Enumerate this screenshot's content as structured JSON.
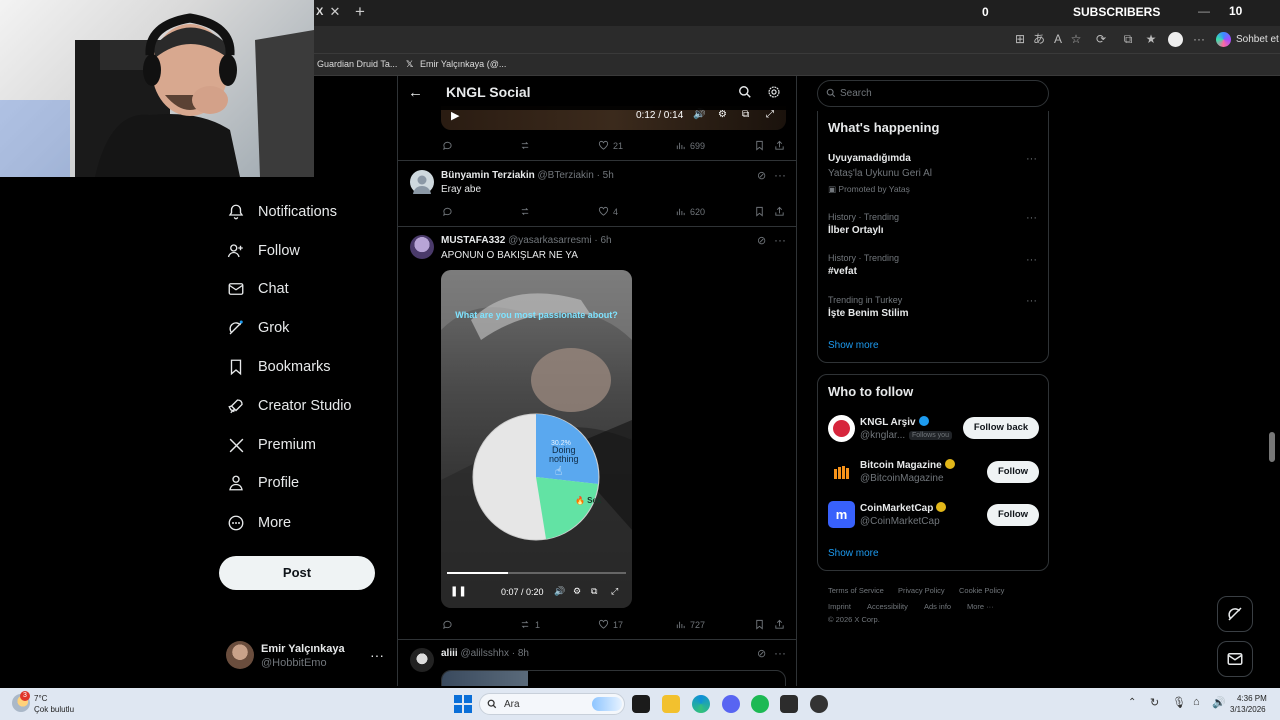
{
  "browser": {
    "tab_close": "✕",
    "new_tab": "+",
    "favorites": [
      "Guardian Druid Ta...",
      "Emir Yalçınkaya (@..."
    ],
    "copilot_label": "Sohbet et",
    "more_menu": "···"
  },
  "stream_overlay": {
    "subscriber_count": "0",
    "subscribers_label": "SUBSCRIBERS",
    "tab_count": "10",
    "tab_x": "X"
  },
  "nav": {
    "items": [
      {
        "label": "Notifications",
        "icon": "bell-icon"
      },
      {
        "label": "Follow",
        "icon": "person-plus-icon"
      },
      {
        "label": "Chat",
        "icon": "mail-icon"
      },
      {
        "label": "Grok",
        "icon": "grok-icon"
      },
      {
        "label": "Bookmarks",
        "icon": "bookmark-icon"
      },
      {
        "label": "Creator Studio",
        "icon": "rocket-icon"
      },
      {
        "label": "Premium",
        "icon": "x-logo-icon"
      },
      {
        "label": "Profile",
        "icon": "person-icon"
      },
      {
        "label": "More",
        "icon": "more-circle-icon"
      }
    ],
    "post_label": "Post",
    "account": {
      "name": "Emir Yalçınkaya",
      "handle": "@HobbitEmo",
      "more": "···"
    }
  },
  "header": {
    "title": "KNGL Social"
  },
  "top_video": {
    "time": "0:12 / 0:14"
  },
  "posts": [
    {
      "actions": {
        "replies": "",
        "reposts": "",
        "likes": "21",
        "views": "699"
      }
    },
    {
      "name": "Bünyamin Terziakin",
      "handle": "@BTerziakin",
      "time": "· 5h",
      "text": "Eray abe",
      "actions": {
        "replies": "",
        "reposts": "",
        "likes": "4",
        "views": "620"
      }
    },
    {
      "name": "MUSTAFA332",
      "handle": "@yasarkasarresmi",
      "time": "· 6h",
      "text": "APONUN O BAKIŞLAR NE YA",
      "video": {
        "question": "What are you most passionate about?",
        "slice_pct": "30.2%",
        "slice_label_1": "Doing",
        "slice_label_2": "nothing",
        "slice2_label": "🔥 Sex",
        "time": "0:07 / 0:20",
        "progress": 0.34
      },
      "actions": {
        "replies": "",
        "reposts": "1",
        "likes": "17",
        "views": "727"
      }
    },
    {
      "name": "aliii",
      "handle": "@alilsshhx",
      "time": "· 8h"
    }
  ],
  "right": {
    "search_placeholder": "Search",
    "happening_title": "What's happening",
    "trends": [
      {
        "category": "",
        "name": "Uyuyamadığımda",
        "sub": "Yataş'la Uykunu Geri Al",
        "promo": "Promoted by Yataş"
      },
      {
        "category": "History · Trending",
        "name": "İlber Ortaylı"
      },
      {
        "category": "History · Trending",
        "name": "#vefat"
      },
      {
        "category": "Trending in Turkey",
        "name": "İşte Benim Stilim"
      }
    ],
    "trend_more": "···",
    "show_more": "Show more",
    "wtf_title": "Who to follow",
    "wtf": [
      {
        "name": "KNGL Arşiv",
        "handle": "@knglar...",
        "badge": "Follows you",
        "button": "Follow back",
        "verified_color": "#1d9bf0"
      },
      {
        "name": "Bitcoin Magazine",
        "handle": "@BitcoinMagazine",
        "button": "Follow",
        "verified_color": "#e2b719"
      },
      {
        "name": "CoinMarketCap",
        "handle": "@CoinMarketCap",
        "button": "Follow",
        "verified_color": "#e2b719"
      }
    ],
    "wtf_show_more": "Show more",
    "footer": [
      "Terms of Service",
      "Privacy Policy",
      "Cookie Policy",
      "Imprint",
      "Accessibility",
      "Ads info",
      "More ···",
      "© 2026 X Corp."
    ]
  },
  "taskbar": {
    "weather_temp": "7°C",
    "weather_desc": "Çok bulutlu",
    "notif_badge": "3",
    "search_label": "Ara",
    "time": "4:36 PM",
    "date": "3/13/2026"
  }
}
